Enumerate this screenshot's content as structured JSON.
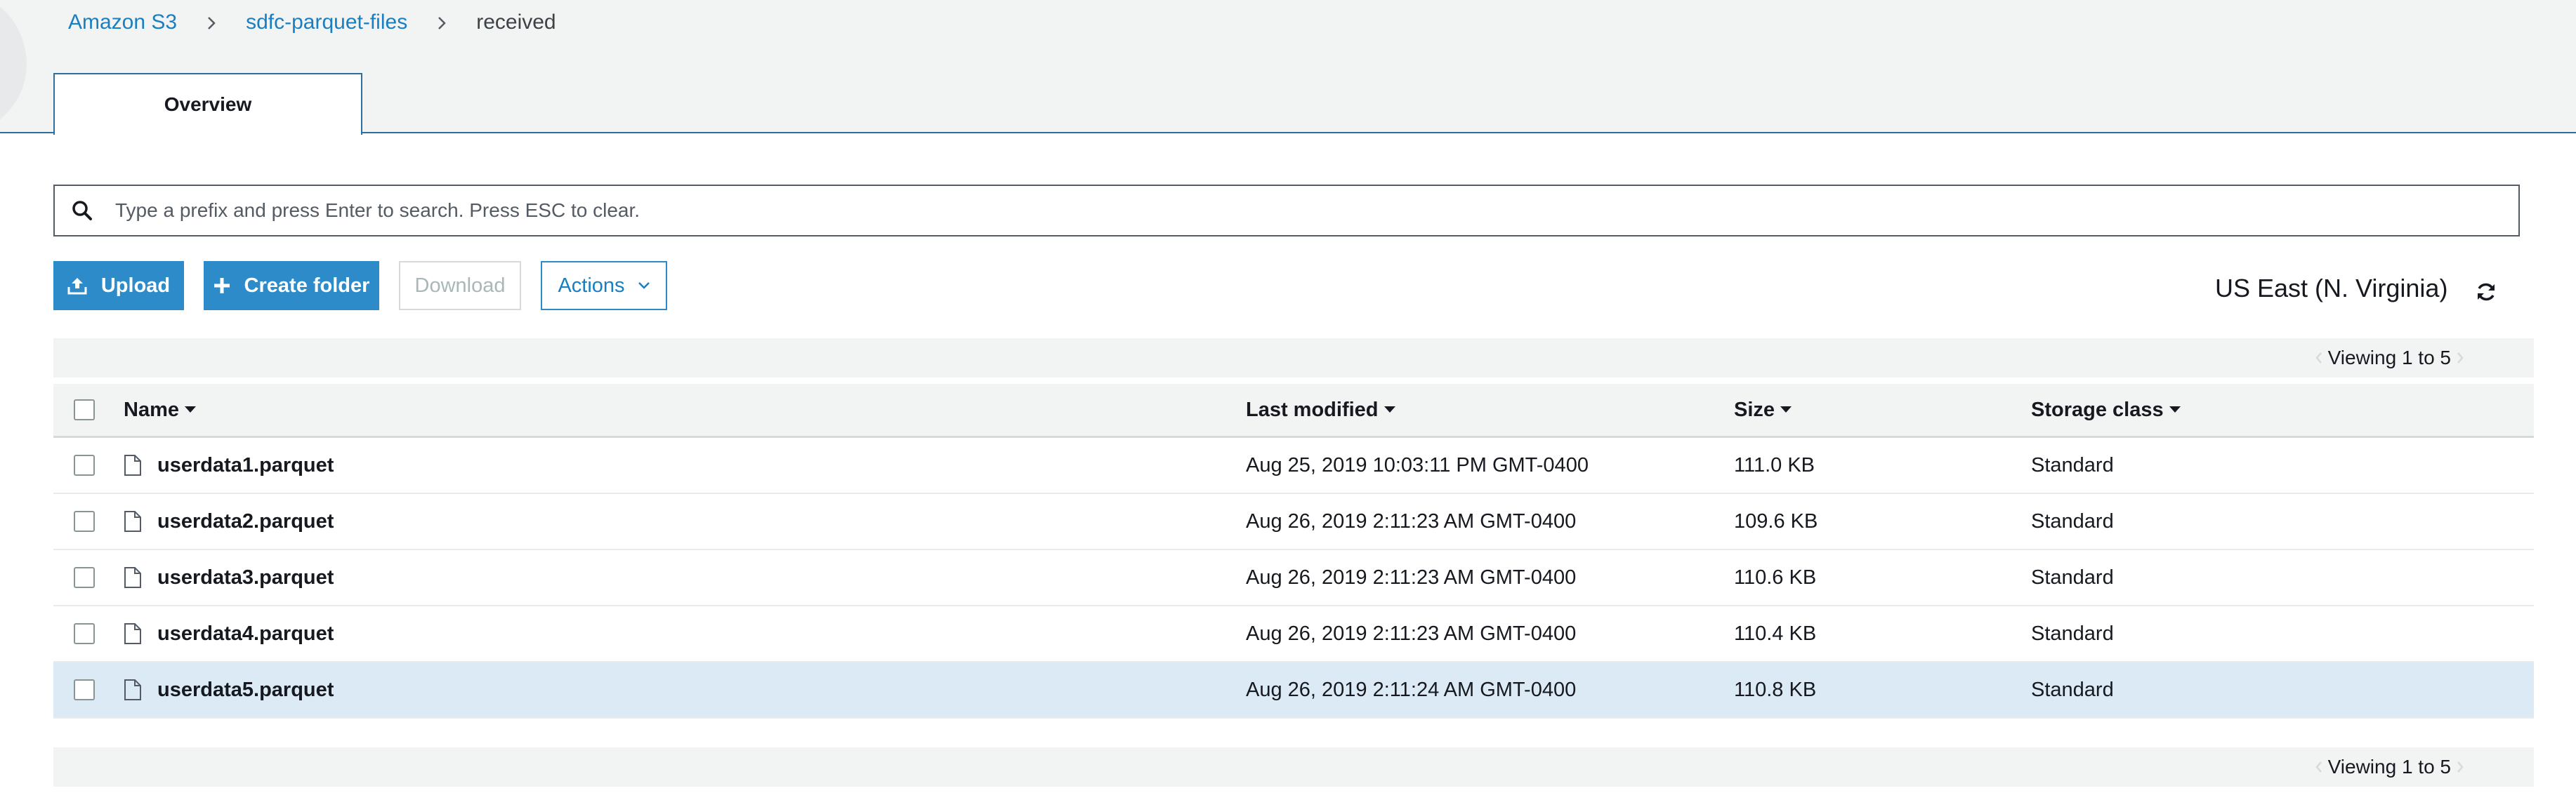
{
  "breadcrumb": {
    "items": [
      "Amazon S3",
      "sdfc-parquet-files"
    ],
    "current": "received"
  },
  "tabs": [
    {
      "label": "Overview"
    }
  ],
  "search": {
    "placeholder": "Type a prefix and press Enter to search. Press ESC to clear.",
    "value": ""
  },
  "toolbar": {
    "upload_label": "Upload",
    "create_folder_label": "Create folder",
    "download_label": "Download",
    "actions_label": "Actions"
  },
  "region": "US East (N. Virginia)",
  "pagination": {
    "viewing_label": "Viewing 1 to 5"
  },
  "table": {
    "columns": [
      "Name",
      "Last modified",
      "Size",
      "Storage class"
    ],
    "rows": [
      {
        "name": "userdata1.parquet",
        "modified": "Aug 25, 2019 10:03:11 PM GMT-0400",
        "size": "111.0 KB",
        "storage_class": "Standard",
        "highlighted": false
      },
      {
        "name": "userdata2.parquet",
        "modified": "Aug 26, 2019 2:11:23 AM GMT-0400",
        "size": "109.6 KB",
        "storage_class": "Standard",
        "highlighted": false
      },
      {
        "name": "userdata3.parquet",
        "modified": "Aug 26, 2019 2:11:23 AM GMT-0400",
        "size": "110.6 KB",
        "storage_class": "Standard",
        "highlighted": false
      },
      {
        "name": "userdata4.parquet",
        "modified": "Aug 26, 2019 2:11:23 AM GMT-0400",
        "size": "110.4 KB",
        "storage_class": "Standard",
        "highlighted": false
      },
      {
        "name": "userdata5.parquet",
        "modified": "Aug 26, 2019 2:11:24 AM GMT-0400",
        "size": "110.8 KB",
        "storage_class": "Standard",
        "highlighted": true
      }
    ]
  },
  "colors": {
    "link": "#1a7fc1",
    "primary_button": "#2e8bc9",
    "tab_border": "#2f6f9c",
    "header_bg": "#f2f3f3",
    "selected_row": "#dbeaf5"
  },
  "icons": {
    "breadcrumb_separator": "chevron-right-icon",
    "search": "search-icon",
    "upload": "upload-icon",
    "create_folder": "plus-icon",
    "actions": "chevron-down-icon",
    "refresh": "refresh-icon",
    "file": "file-icon",
    "sort": "caret-down-icon"
  }
}
